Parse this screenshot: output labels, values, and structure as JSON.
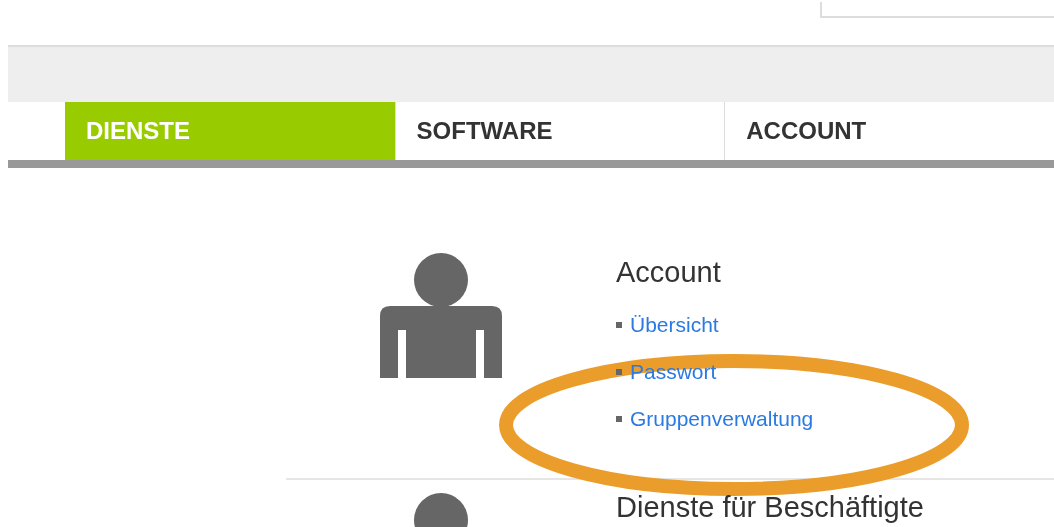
{
  "tabs": [
    {
      "label": "DIENSTE",
      "selected": true
    },
    {
      "label": "SOFTWARE",
      "selected": false
    },
    {
      "label": "ACCOUNT",
      "selected": false
    }
  ],
  "sections": [
    {
      "title": "Account",
      "links": [
        "Übersicht",
        "Passwort",
        "Gruppenverwaltung"
      ]
    },
    {
      "title": "Dienste für Beschäftigte"
    }
  ]
}
